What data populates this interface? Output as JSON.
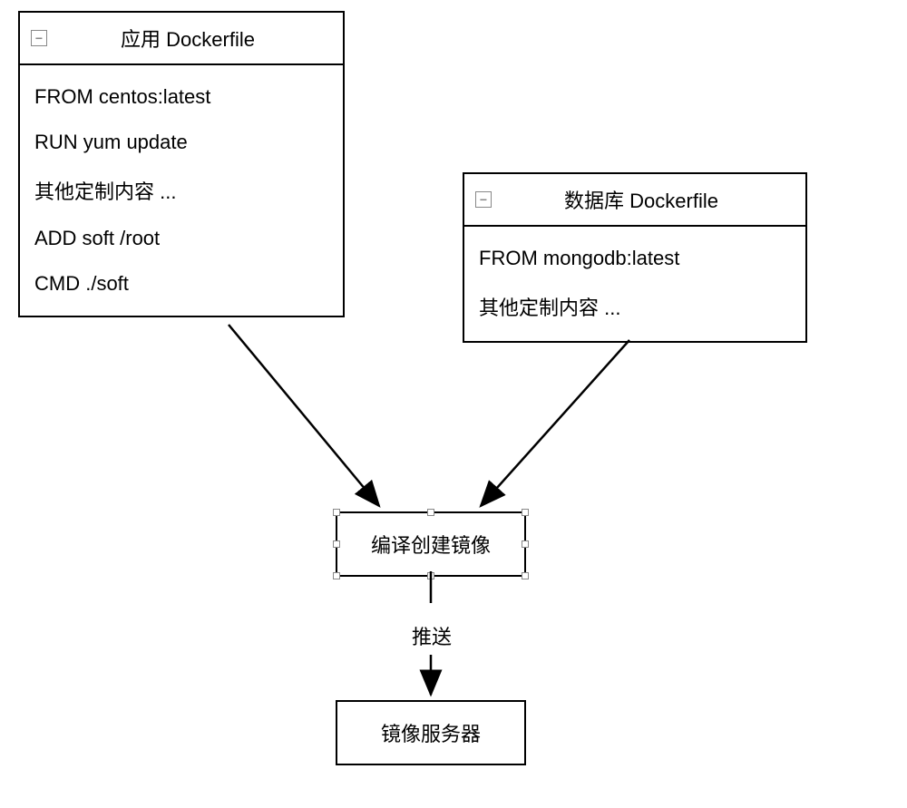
{
  "dockerfile_app": {
    "title": "应用 Dockerfile",
    "lines": [
      "FROM centos:latest",
      "RUN yum update",
      "其他定制内容 ...",
      "ADD soft /root",
      "CMD ./soft"
    ]
  },
  "dockerfile_db": {
    "title": "数据库 Dockerfile",
    "lines": [
      "FROM mongodb:latest",
      "其他定制内容 ..."
    ]
  },
  "compile_label": "编译创建镜像",
  "push_label": "推送",
  "server_label": "镜像服务器",
  "collapse_icon": "−"
}
